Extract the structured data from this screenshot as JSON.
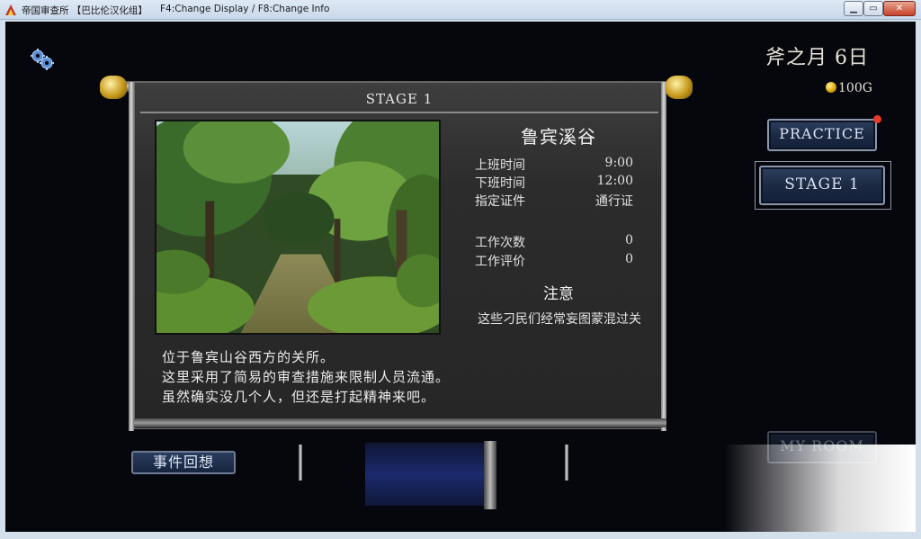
{
  "window": {
    "title": "帝国审查所 【巴比伦汉化组】",
    "hint": "F4:Change Display / F8:Change Info",
    "minimize_label": "▁",
    "maximize_label": "▭",
    "close_label": "✕"
  },
  "hud": {
    "date": "斧之月  6日",
    "gold": "100G"
  },
  "menu": {
    "practice": "PRACTICE",
    "stage1": "STAGE 1",
    "my_room": "MY ROOM"
  },
  "stage_panel": {
    "title": "STAGE 1",
    "location": "鲁宾溪谷",
    "rows": [
      {
        "label": "上班时间",
        "value": "9:00"
      },
      {
        "label": "下班时间",
        "value": "12:00"
      },
      {
        "label": "指定证件",
        "value": "通行证"
      },
      {
        "label": "工作次数",
        "value": "0"
      },
      {
        "label": "工作评价",
        "value": "0"
      }
    ],
    "notice_heading": "注意",
    "notice_text": "这些刁民们经常妄图蒙混过关",
    "description": [
      "位于鲁宾山谷西方的关所。",
      "这里采用了简易的审查措施来限制人员流通。",
      "虽然确实没几个人，但还是打起精神来吧。"
    ]
  },
  "bottom": {
    "events_button": "事件回想"
  },
  "icons": {
    "settings": "gears-icon",
    "gold": "coin-icon",
    "app": "app-icon"
  },
  "colors": {
    "background": "#06070d",
    "button_fill": "#1b2840",
    "notification": "#e63c2e",
    "coin": "#d9a400"
  }
}
